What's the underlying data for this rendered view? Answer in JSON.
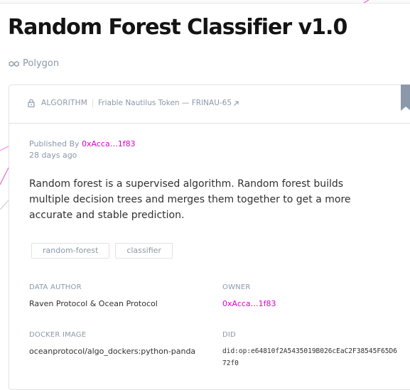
{
  "page": {
    "title": "Random Forest Classifier v1.0",
    "network": "Polygon"
  },
  "asset": {
    "type": "ALGORITHM",
    "token": "Friable Nautilus Token — FRINAU-65",
    "published_by_label": "Published By",
    "publisher": "0xAcca…1f83",
    "published_ago": "28 days ago",
    "description": "Random forest is a supervised algorithm. Random forest builds multiple decision trees and merges them together to get a more accurate and stable prediction.",
    "tags": [
      "random-forest",
      "classifier"
    ]
  },
  "metadata": {
    "data_author": {
      "label": "DATA AUTHOR",
      "value": "Raven Protocol & Ocean Protocol"
    },
    "owner": {
      "label": "OWNER",
      "value": "0xAcca…1f83"
    },
    "docker_image": {
      "label": "DOCKER IMAGE",
      "value": "oceanprotocol/algo_dockers:python-panda"
    },
    "did": {
      "label": "DID",
      "value": "did:op:e64810f2A5435019B026cEaC2F38545F65D672f0"
    }
  },
  "icons": {
    "network": "polygon-icon",
    "lock": "lock-icon",
    "external": "external-link-icon",
    "bookmark": "bookmark-icon"
  },
  "colors": {
    "accent": "#e000cf",
    "muted": "#8b98a9",
    "text": "#303030",
    "title": "#141414",
    "border": "#e2e2e2",
    "bookmark": "#8b98a9"
  }
}
